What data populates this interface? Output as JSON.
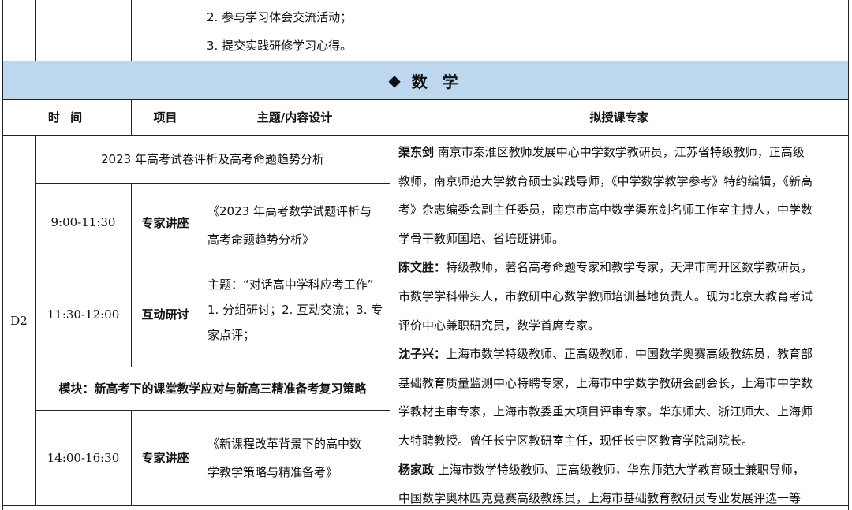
{
  "top_row": {
    "item2": "2. 参与学习体会交流活动；",
    "item3": "3. 提交实践研修学习心得。"
  },
  "section_header": {
    "bullet": "◆",
    "title": "数 学"
  },
  "table_header": {
    "time": "时 间",
    "project": "项目",
    "topic": "主题/内容设计",
    "experts": "拟授课专家"
  },
  "day_label": "D2",
  "sessions": [
    {
      "kind": "banner",
      "text": "2023 年高考试卷评析及高考命题趋势分析"
    },
    {
      "kind": "row",
      "time": "9:00-11:30",
      "project": "专家讲座",
      "topic_lines": [
        "《2023 年高考数学试题评析与",
        "高考命题趋势分析》"
      ]
    },
    {
      "kind": "row",
      "time": "11:30-12:00",
      "project": "互动研讨",
      "topic_lines": [
        "主题：“对话高中学科应考工作”",
        "1. 分组研讨；2. 互动交流；3. 专",
        "家点评；"
      ]
    },
    {
      "kind": "banner",
      "text": "模块：新高考下的课堂教学应对与新高三精准备考复习策略"
    },
    {
      "kind": "row",
      "time": "14:00-16:30",
      "project": "专家讲座",
      "topic_lines": [
        "《新课程改革背景下的高中数",
        "学教学策略与精准备考》"
      ]
    }
  ],
  "experts": [
    {
      "name": "渠东剑",
      "lines": [
        "南京市秦淮区教师发展中心中学数学教研员，江苏省特级教师，正高级",
        "教师，南京师范大学教育硕士实践导师，《中学数学教学参考》特约编辑，《新高",
        "考》杂志编委会副主任委员，南京市高中数学渠东剑名师工作室主持人，中学数",
        "学骨干教师国培、省培班讲师。"
      ]
    },
    {
      "name": "陈文胜：",
      "lines": [
        "特级教师，著名高考命题专家和教学专家，天津市南开区数学教研员，",
        "市数学学科带头人，市教研中心数学教师培训基地负责人。现为北京大教育考试",
        "评价中心兼职研究员，数学首席专家。"
      ]
    },
    {
      "name": "沈子兴：",
      "lines": [
        "上海市数学特级教师、正高级教师，中国数学奥赛高级教练员，教育部",
        "基础教育质量监测中心特聘专家，上海市中学数学教研会副会长，上海市中学数",
        "学教材主审专家，上海市教委重大项目评审专家。华东师大、浙江师大、上海师",
        "大特聘教授。曾任长宁区教研室主任，现任长宁区教育学院副院长。"
      ]
    },
    {
      "name": "杨家政",
      "lines": [
        "上海市数学特级教师、正高级教师，华东师范大学教育硕士兼职导师，",
        "中国数学奥林匹克竞赛高级教练员，上海市基础教育教研员专业发展评选一等"
      ]
    }
  ]
}
